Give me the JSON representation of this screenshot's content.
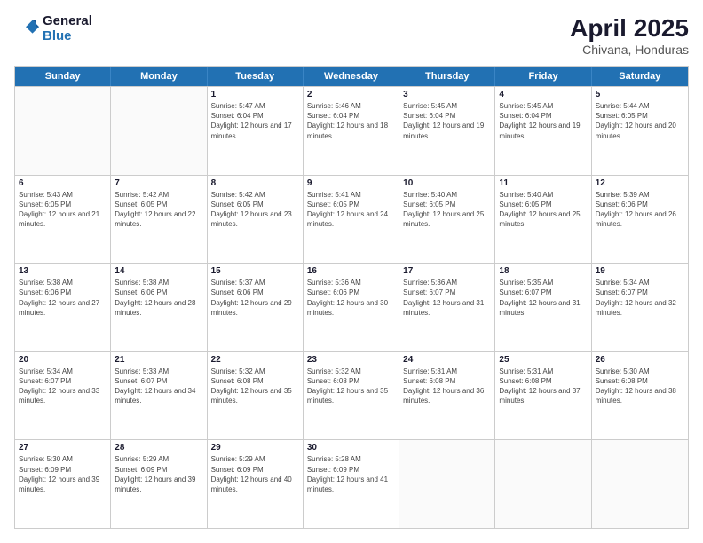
{
  "logo": {
    "general": "General",
    "blue": "Blue"
  },
  "title": "April 2025",
  "subtitle": "Chivana, Honduras",
  "days_of_week": [
    "Sunday",
    "Monday",
    "Tuesday",
    "Wednesday",
    "Thursday",
    "Friday",
    "Saturday"
  ],
  "weeks": [
    [
      {
        "day": "",
        "empty": true
      },
      {
        "day": "",
        "empty": true
      },
      {
        "day": "1",
        "sunrise": "Sunrise: 5:47 AM",
        "sunset": "Sunset: 6:04 PM",
        "daylight": "Daylight: 12 hours and 17 minutes."
      },
      {
        "day": "2",
        "sunrise": "Sunrise: 5:46 AM",
        "sunset": "Sunset: 6:04 PM",
        "daylight": "Daylight: 12 hours and 18 minutes."
      },
      {
        "day": "3",
        "sunrise": "Sunrise: 5:45 AM",
        "sunset": "Sunset: 6:04 PM",
        "daylight": "Daylight: 12 hours and 19 minutes."
      },
      {
        "day": "4",
        "sunrise": "Sunrise: 5:45 AM",
        "sunset": "Sunset: 6:04 PM",
        "daylight": "Daylight: 12 hours and 19 minutes."
      },
      {
        "day": "5",
        "sunrise": "Sunrise: 5:44 AM",
        "sunset": "Sunset: 6:05 PM",
        "daylight": "Daylight: 12 hours and 20 minutes."
      }
    ],
    [
      {
        "day": "6",
        "sunrise": "Sunrise: 5:43 AM",
        "sunset": "Sunset: 6:05 PM",
        "daylight": "Daylight: 12 hours and 21 minutes."
      },
      {
        "day": "7",
        "sunrise": "Sunrise: 5:42 AM",
        "sunset": "Sunset: 6:05 PM",
        "daylight": "Daylight: 12 hours and 22 minutes."
      },
      {
        "day": "8",
        "sunrise": "Sunrise: 5:42 AM",
        "sunset": "Sunset: 6:05 PM",
        "daylight": "Daylight: 12 hours and 23 minutes."
      },
      {
        "day": "9",
        "sunrise": "Sunrise: 5:41 AM",
        "sunset": "Sunset: 6:05 PM",
        "daylight": "Daylight: 12 hours and 24 minutes."
      },
      {
        "day": "10",
        "sunrise": "Sunrise: 5:40 AM",
        "sunset": "Sunset: 6:05 PM",
        "daylight": "Daylight: 12 hours and 25 minutes."
      },
      {
        "day": "11",
        "sunrise": "Sunrise: 5:40 AM",
        "sunset": "Sunset: 6:05 PM",
        "daylight": "Daylight: 12 hours and 25 minutes."
      },
      {
        "day": "12",
        "sunrise": "Sunrise: 5:39 AM",
        "sunset": "Sunset: 6:06 PM",
        "daylight": "Daylight: 12 hours and 26 minutes."
      }
    ],
    [
      {
        "day": "13",
        "sunrise": "Sunrise: 5:38 AM",
        "sunset": "Sunset: 6:06 PM",
        "daylight": "Daylight: 12 hours and 27 minutes."
      },
      {
        "day": "14",
        "sunrise": "Sunrise: 5:38 AM",
        "sunset": "Sunset: 6:06 PM",
        "daylight": "Daylight: 12 hours and 28 minutes."
      },
      {
        "day": "15",
        "sunrise": "Sunrise: 5:37 AM",
        "sunset": "Sunset: 6:06 PM",
        "daylight": "Daylight: 12 hours and 29 minutes."
      },
      {
        "day": "16",
        "sunrise": "Sunrise: 5:36 AM",
        "sunset": "Sunset: 6:06 PM",
        "daylight": "Daylight: 12 hours and 30 minutes."
      },
      {
        "day": "17",
        "sunrise": "Sunrise: 5:36 AM",
        "sunset": "Sunset: 6:07 PM",
        "daylight": "Daylight: 12 hours and 31 minutes."
      },
      {
        "day": "18",
        "sunrise": "Sunrise: 5:35 AM",
        "sunset": "Sunset: 6:07 PM",
        "daylight": "Daylight: 12 hours and 31 minutes."
      },
      {
        "day": "19",
        "sunrise": "Sunrise: 5:34 AM",
        "sunset": "Sunset: 6:07 PM",
        "daylight": "Daylight: 12 hours and 32 minutes."
      }
    ],
    [
      {
        "day": "20",
        "sunrise": "Sunrise: 5:34 AM",
        "sunset": "Sunset: 6:07 PM",
        "daylight": "Daylight: 12 hours and 33 minutes."
      },
      {
        "day": "21",
        "sunrise": "Sunrise: 5:33 AM",
        "sunset": "Sunset: 6:07 PM",
        "daylight": "Daylight: 12 hours and 34 minutes."
      },
      {
        "day": "22",
        "sunrise": "Sunrise: 5:32 AM",
        "sunset": "Sunset: 6:08 PM",
        "daylight": "Daylight: 12 hours and 35 minutes."
      },
      {
        "day": "23",
        "sunrise": "Sunrise: 5:32 AM",
        "sunset": "Sunset: 6:08 PM",
        "daylight": "Daylight: 12 hours and 35 minutes."
      },
      {
        "day": "24",
        "sunrise": "Sunrise: 5:31 AM",
        "sunset": "Sunset: 6:08 PM",
        "daylight": "Daylight: 12 hours and 36 minutes."
      },
      {
        "day": "25",
        "sunrise": "Sunrise: 5:31 AM",
        "sunset": "Sunset: 6:08 PM",
        "daylight": "Daylight: 12 hours and 37 minutes."
      },
      {
        "day": "26",
        "sunrise": "Sunrise: 5:30 AM",
        "sunset": "Sunset: 6:08 PM",
        "daylight": "Daylight: 12 hours and 38 minutes."
      }
    ],
    [
      {
        "day": "27",
        "sunrise": "Sunrise: 5:30 AM",
        "sunset": "Sunset: 6:09 PM",
        "daylight": "Daylight: 12 hours and 39 minutes."
      },
      {
        "day": "28",
        "sunrise": "Sunrise: 5:29 AM",
        "sunset": "Sunset: 6:09 PM",
        "daylight": "Daylight: 12 hours and 39 minutes."
      },
      {
        "day": "29",
        "sunrise": "Sunrise: 5:29 AM",
        "sunset": "Sunset: 6:09 PM",
        "daylight": "Daylight: 12 hours and 40 minutes."
      },
      {
        "day": "30",
        "sunrise": "Sunrise: 5:28 AM",
        "sunset": "Sunset: 6:09 PM",
        "daylight": "Daylight: 12 hours and 41 minutes."
      },
      {
        "day": "",
        "empty": true
      },
      {
        "day": "",
        "empty": true
      },
      {
        "day": "",
        "empty": true
      }
    ]
  ]
}
